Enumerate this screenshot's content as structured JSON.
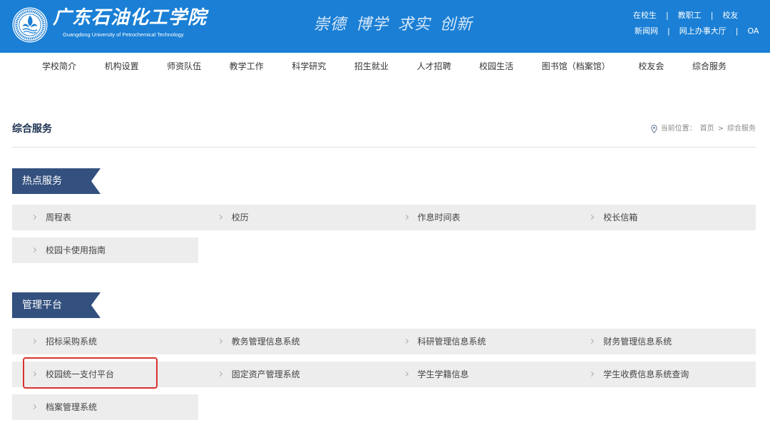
{
  "header": {
    "logo": {
      "name_cn": "广东石油化工学院",
      "name_en": "Guangdong University of Petrochemical Technology"
    },
    "motto": "崇德 博学 求实 创新",
    "links_row1": [
      "在校生",
      "教职工",
      "校友"
    ],
    "links_row2": [
      "新闻网",
      "网上办事大厅",
      "OA"
    ],
    "separator": "|"
  },
  "nav": {
    "items": [
      "学校简介",
      "机构设置",
      "师资队伍",
      "教学工作",
      "科学研究",
      "招生就业",
      "人才招聘",
      "校园生活",
      "图书馆（档案馆）",
      "校友会",
      "综合服务"
    ]
  },
  "page": {
    "title": "综合服务"
  },
  "breadcrumb": {
    "label": "当前位置：",
    "home": "首页",
    "separator": ">",
    "current": "综合服务"
  },
  "sections": [
    {
      "title": "热点服务",
      "items": [
        "周程表",
        "校历",
        "作息时间表",
        "校长信箱",
        "校园卡使用指南"
      ]
    },
    {
      "title": "管理平台",
      "items": [
        "招标采购系统",
        "教务管理信息系统",
        "科研管理信息系统",
        "财务管理信息系统",
        "校园统一支付平台",
        "固定资产管理系统",
        "学生学籍信息",
        "学生收费信息系统查询",
        "档案管理系统"
      ]
    }
  ],
  "icons": {
    "logo": "university-emblem-icon",
    "breadcrumb": "location-pin-icon",
    "list_item": "chevron-right-icon"
  },
  "colors": {
    "header_bg": "#1a7fd5",
    "section_tab_bg": "#33507e",
    "cell_bg": "#ededed",
    "title": "#1b3050",
    "highlight": "#d8322f"
  }
}
